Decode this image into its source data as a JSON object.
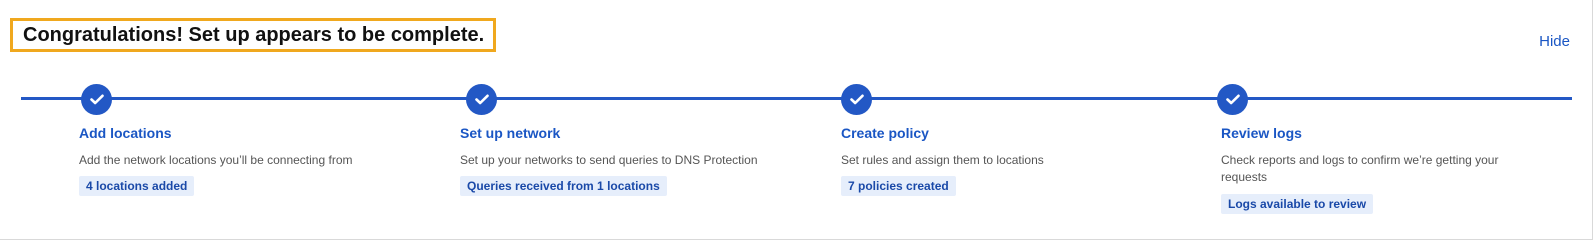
{
  "header": {
    "title": "Congratulations! Set up appears to be complete.",
    "hide_label": "Hide"
  },
  "steps": [
    {
      "title": "Add locations",
      "description": "Add the network locations you’ll be connecting from",
      "badge": "4 locations added",
      "status": "complete"
    },
    {
      "title": "Set up network",
      "description": "Set up your networks to send queries to DNS Protection",
      "badge": "Queries received from 1 locations",
      "status": "complete"
    },
    {
      "title": "Create policy",
      "description": "Set rules and assign them to locations",
      "badge": "7 policies created",
      "status": "complete"
    },
    {
      "title": "Review logs",
      "description": "Check reports and logs to confirm we’re getting your requests",
      "badge": "Logs available to review",
      "status": "complete"
    }
  ],
  "colors": {
    "accent": "#2358c5",
    "title_highlight": "#f0a81e",
    "badge_bg": "#e6eefb"
  },
  "icons": {
    "step_complete": "checkmark-icon"
  }
}
